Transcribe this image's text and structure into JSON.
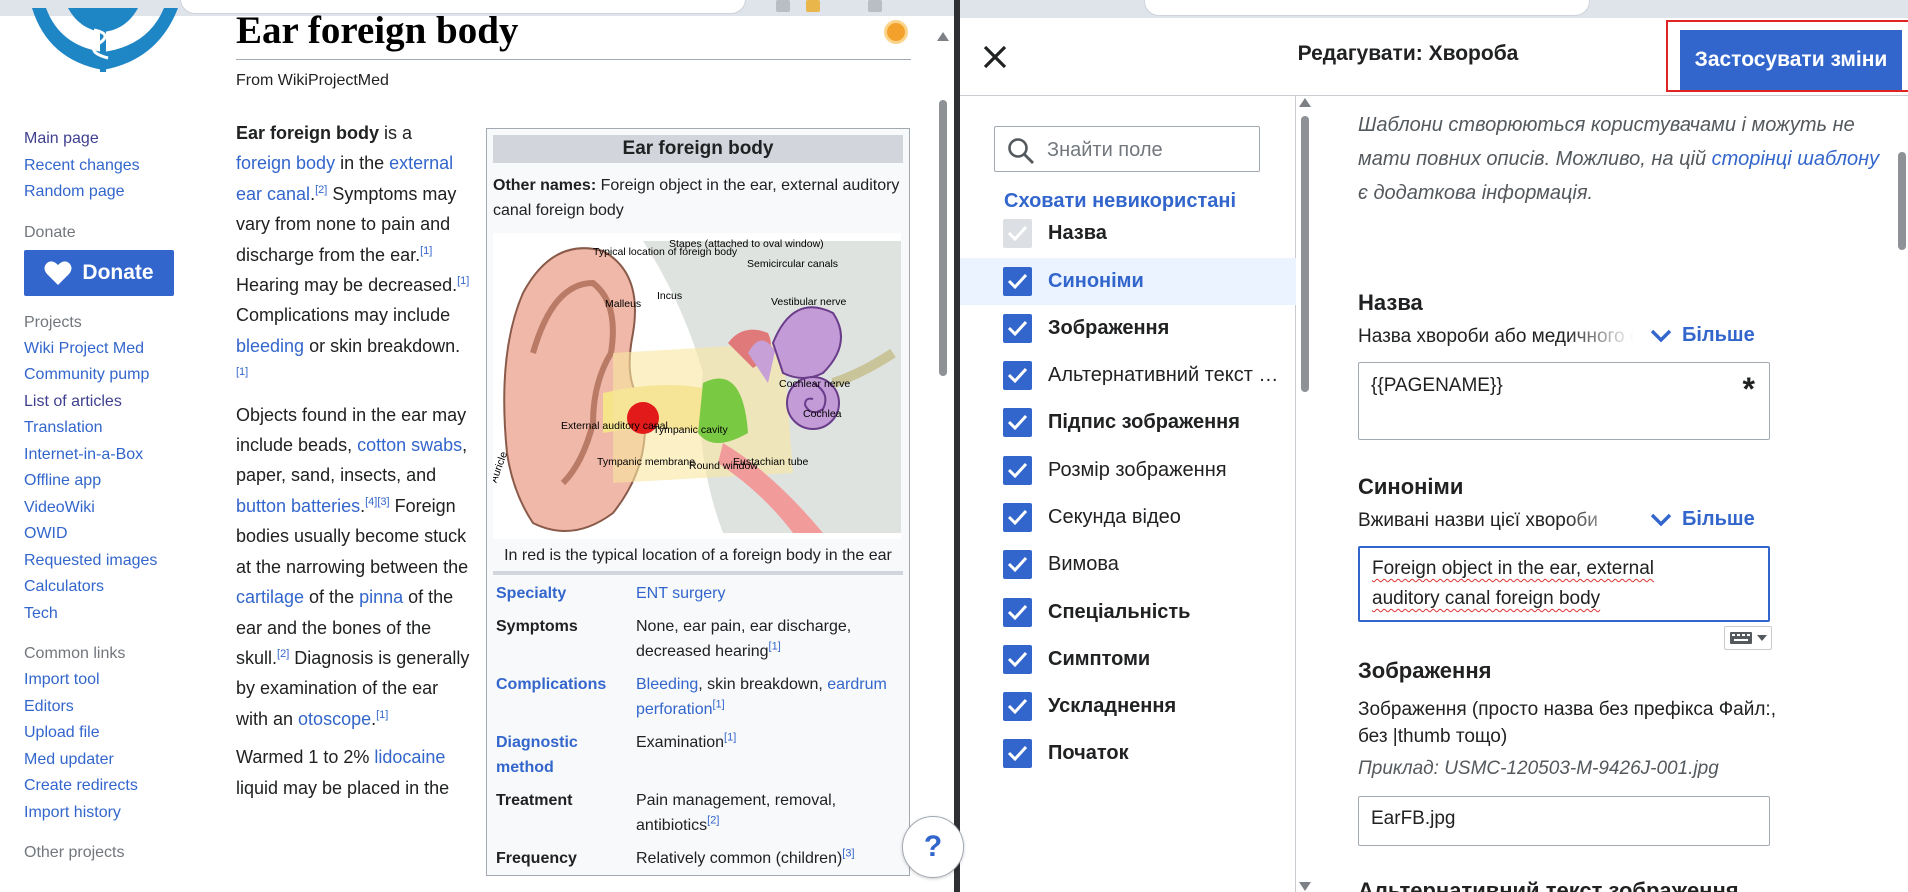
{
  "left": {
    "sidebar": {
      "nav": [
        "Main page",
        "Recent changes",
        "Random page"
      ],
      "donate_heading": "Donate",
      "donate_button": "Donate",
      "projects_heading": "Projects",
      "projects": [
        "Wiki Project Med",
        "Community pump",
        "List of articles",
        "Translation",
        "Internet-in-a-Box",
        "Offline app",
        "VideoWiki",
        "OWID",
        "Requested images",
        "Calculators",
        "Tech"
      ],
      "common_heading": "Common links",
      "common": [
        "Import tool",
        "Editors",
        "Upload file",
        "Med updater",
        "Create redirects",
        "Import history"
      ],
      "other_heading": "Other projects"
    },
    "article": {
      "title": "Ear foreign body",
      "from": "From WikiProjectMed",
      "p1": {
        "t0": "Ear foreign body",
        "t1": " is a ",
        "l1": "foreign body",
        "t2": " in the ",
        "l2": "external ear canal",
        "t3": ".",
        "r1": "[2]",
        "t4": " Symptoms may vary from none to pain and discharge from the ear.",
        "r2": "[1]",
        "t5": " Hearing may be decreased.",
        "r3": "[1]",
        "t6": " Complications may include ",
        "l3": "bleeding",
        "t7": " or skin breakdown.",
        "r4": "[1]"
      },
      "p2": {
        "t0": "Objects found in the ear may include beads, ",
        "l1": "cotton swabs",
        "t1": ", paper, sand, insects, and ",
        "l2": "button batteries",
        "t2": ".",
        "r1": "[4][3]",
        "t3": " Foreign bodies usually become stuck at the narrowing between the ",
        "l3": "cartilage",
        "t4": " of the ",
        "l4": "pinna",
        "t5": " of the ear and the bones of the skull.",
        "r2": "[2]",
        "t6": " Diagnosis is generally by examination of the ear with an ",
        "l5": "otoscope",
        "t7": ".",
        "r3": "[1]"
      },
      "p3": {
        "t0": "Warmed 1 to 2% ",
        "l1": "lidocaine",
        "t1": " liquid may be placed in the"
      }
    },
    "infobox": {
      "title": "Ear foreign body",
      "other_names_label": "Other names:",
      "other_names": " Foreign object in the ear, external auditory canal foreign body",
      "diagram_labels": {
        "typical": "Typical location of foreign body",
        "stapes": "Stapes (attached to oval window)",
        "semicircular": "Semicircular canals",
        "incus": "Incus",
        "malleus": "Malleus",
        "vestibular": "Vestibular nerve",
        "cochlear_nerve": "Cochlear nerve",
        "cochlea": "Cochlea",
        "external": "External auditory canal",
        "tympanic_cavity": "Tympanic cavity",
        "auricle": "Auricle",
        "tympanic_membrane": "Tympanic membrane",
        "round_window": "Round window",
        "eustachian": "Eustachian tube"
      },
      "caption": "In red is the typical location of a foreign body in the ear",
      "rows": [
        {
          "key": "Specialty",
          "key_link": true,
          "value_html": [
            {
              "link": "ENT surgery"
            }
          ]
        },
        {
          "key": "Symptoms",
          "key_link": false,
          "value_html": [
            {
              "text": "None, ear pain, ear discharge, decreased hearing"
            },
            {
              "ref": "[1]"
            }
          ]
        },
        {
          "key": "Complications",
          "key_link": true,
          "value_html": [
            {
              "link": "Bleeding"
            },
            {
              "text": ", skin breakdown, "
            },
            {
              "link": "eardrum perforation"
            },
            {
              "ref": "[1]"
            }
          ]
        },
        {
          "key": "Diagnostic method",
          "key_link": true,
          "value_html": [
            {
              "text": "Examination"
            },
            {
              "ref": "[1]"
            }
          ]
        },
        {
          "key": "Treatment",
          "key_link": false,
          "value_html": [
            {
              "text": "Pain management, removal, antibiotics"
            },
            {
              "ref": "[2]"
            }
          ]
        },
        {
          "key": "Frequency",
          "key_link": false,
          "value_html": [
            {
              "text": "Relatively common (children)"
            },
            {
              "ref": "[3]"
            }
          ]
        }
      ]
    }
  },
  "right": {
    "header": {
      "title": "Редагувати: Хвороба",
      "apply_button": "Застосувати зміни"
    },
    "fields_panel": {
      "search_placeholder": "Знайти поле",
      "hide_unused": "Сховати невикористані",
      "items": [
        {
          "label": "Назва",
          "bold": true,
          "disabled": true,
          "selected": false
        },
        {
          "label": "Синоніми",
          "bold": true,
          "disabled": false,
          "selected": true
        },
        {
          "label": "Зображення",
          "bold": true,
          "disabled": false,
          "selected": false
        },
        {
          "label": "Альтернативний текст …",
          "bold": false,
          "disabled": false,
          "selected": false
        },
        {
          "label": "Підпис зображення",
          "bold": true,
          "disabled": false,
          "selected": false
        },
        {
          "label": "Розмір зображення",
          "bold": false,
          "disabled": false,
          "selected": false
        },
        {
          "label": "Секунда відео",
          "bold": false,
          "disabled": false,
          "selected": false
        },
        {
          "label": "Вимова",
          "bold": false,
          "disabled": false,
          "selected": false
        },
        {
          "label": "Спеціальність",
          "bold": true,
          "disabled": false,
          "selected": false
        },
        {
          "label": "Симптоми",
          "bold": true,
          "disabled": false,
          "selected": false
        },
        {
          "label": "Ускладнення",
          "bold": true,
          "disabled": false,
          "selected": false
        },
        {
          "label": "Початок",
          "bold": true,
          "disabled": false,
          "selected": false
        }
      ]
    },
    "form": {
      "note_a": "Шаблони створюються користувачами і можуть не мати повних описів. Можливо, на цій ",
      "note_link": "сторінці шаблону",
      "note_b": " є додаткова інформація.",
      "more_label": "Більше",
      "name": {
        "label": "Назва",
        "desc": "Назва хвороби або медичного стану",
        "value": "{{PAGENAME}}",
        "required": "*"
      },
      "synonyms": {
        "label": "Синоніми",
        "desc": "Вживані назви цієї хвороби",
        "value_line1": "Foreign object in the ear, external",
        "value_line2": "auditory canal foreign body"
      },
      "image": {
        "label": "Зображення",
        "desc": "Зображення (просто назва без префікса Файл:, без |thumb тощо)",
        "example": "Приклад: USMC-120503-M-9426J-001.jpg",
        "value": "EarFB.jpg"
      },
      "alt": {
        "label": "Альтернативний текст зображення"
      }
    },
    "help": "?"
  }
}
